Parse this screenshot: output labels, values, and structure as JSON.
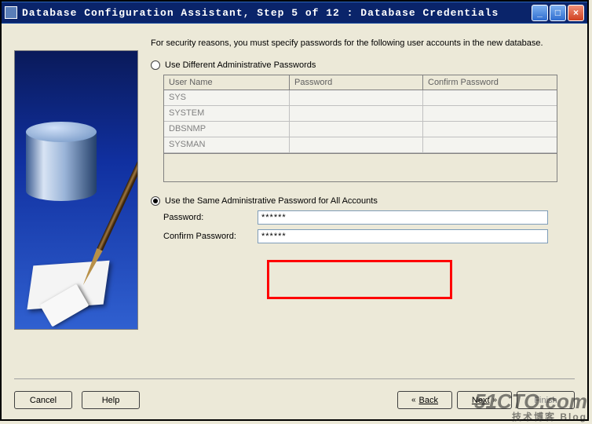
{
  "window": {
    "title": "Database Configuration Assistant, Step 5 of 12 : Database Credentials"
  },
  "instruction": "For security reasons, you must specify passwords for the following user accounts in the new database.",
  "option1": {
    "label": "Use Different Administrative Passwords",
    "selected": false
  },
  "table": {
    "headers": {
      "c1": "User Name",
      "c2": "Password",
      "c3": "Confirm Password"
    },
    "rows": [
      "SYS",
      "SYSTEM",
      "DBSNMP",
      "SYSMAN"
    ]
  },
  "option2": {
    "label": "Use the Same Administrative Password for All Accounts",
    "selected": true,
    "password_label": "Password:",
    "password_value": "******",
    "confirm_label": "Confirm Password:",
    "confirm_value": "******"
  },
  "buttons": {
    "cancel": "Cancel",
    "help": "Help",
    "back": "Back",
    "next": "Next",
    "finish": "Finish"
  },
  "watermark": {
    "line1": "51CTO.com",
    "line2": "技术博客   Blog"
  }
}
